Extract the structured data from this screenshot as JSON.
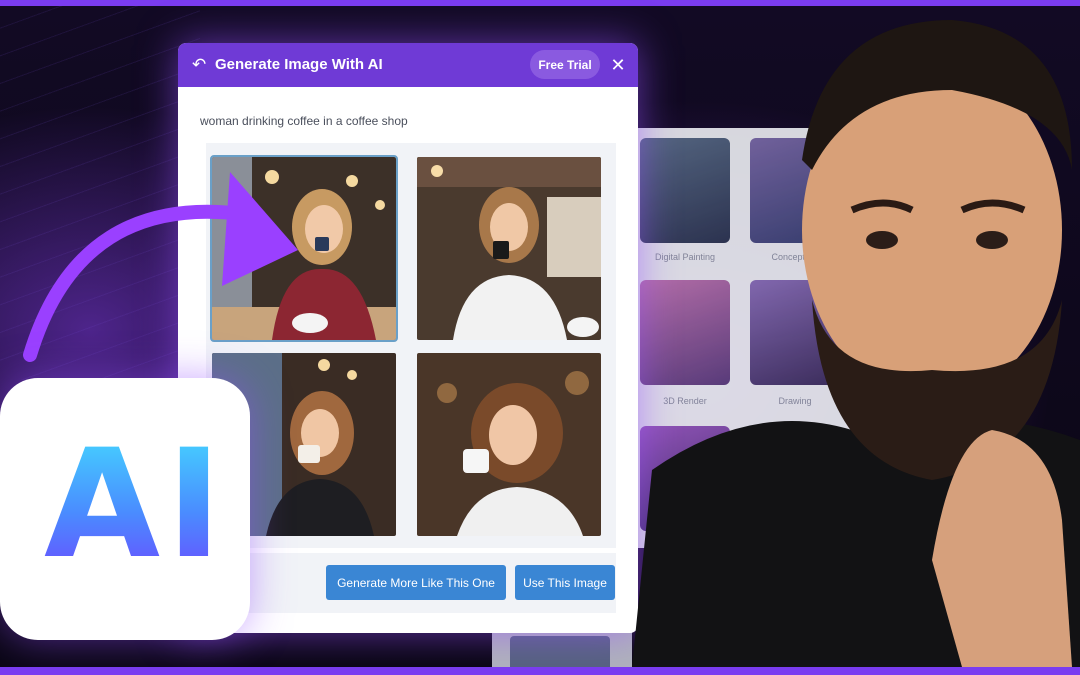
{
  "dialog": {
    "title": "Generate Image With AI",
    "trial_label": "Free Trial",
    "prompt_text": "woman drinking coffee in a coffee shop",
    "generate_more_label": "Generate More Like This One",
    "use_image_label": "Use This Image",
    "selected_image_index": 0
  },
  "logo": {
    "text": "AI"
  },
  "gallery": {
    "labels": [
      "Digital Painting",
      "Concept Art",
      "3D Render",
      "Drawing"
    ]
  },
  "colors": {
    "header": "#6f3ad6",
    "button": "#3a86d4",
    "accent": "#7a3cf0"
  }
}
